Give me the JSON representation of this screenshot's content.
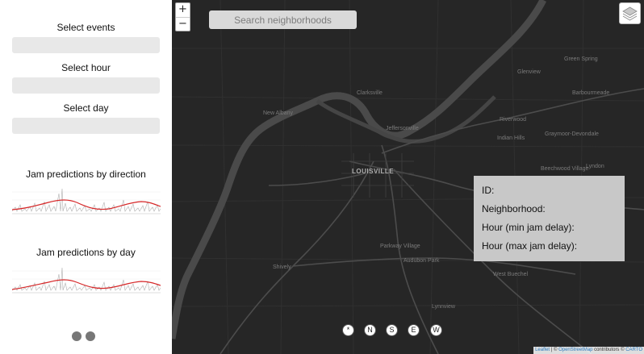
{
  "sidebar": {
    "select_events_label": "Select events",
    "select_hour_label": "Select hour",
    "select_day_label": "Select day",
    "chart_direction_title": "Jam predictions by direction",
    "chart_day_title": "Jam predictions by day",
    "select_events_value": "",
    "select_hour_value": "",
    "select_day_value": ""
  },
  "map": {
    "zoom_in": "+",
    "zoom_out": "−",
    "search_placeholder": "Search neighborhoods",
    "places": {
      "louisville": "LOUISVILLE",
      "new_albany": "New Albany",
      "clarksville": "Clarksville",
      "jeffersonville": "Jeffersonville",
      "shively": "Shively",
      "lyndon": "Lyndon",
      "green_spring": "Green Spring",
      "barbourmeade": "Barbourmeade",
      "riverwood": "Riverwood",
      "crossgate": "Graymoor-Devondale",
      "indian_hills": "Indian Hills",
      "beechwood": "Beechwood Village",
      "parkway": "Parkway Village",
      "audubon": "Audubon Park",
      "west_buechel": "West Buechel",
      "lynnview": "Lynnview",
      "glenview": "Glenview"
    },
    "info": {
      "id_label": "ID:",
      "neighborhood_label": "Neighborhood:",
      "hour_min_label": "Hour (min jam delay):",
      "hour_max_label": "Hour (max jam delay):"
    },
    "direction_buttons": [
      "*",
      "N",
      "S",
      "E",
      "W"
    ],
    "attribution": {
      "leaflet": "Leaflet",
      "sep": " | © ",
      "osm": "OpenStreetMap",
      "contrib": " contributors © ",
      "carto": "CARTO"
    }
  },
  "colors": {
    "map_bg": "#262626",
    "river": "#4a4a4a",
    "trend_line": "#d62728",
    "spikes": "#b0b0b0",
    "info_bg": "#c8c8c8"
  }
}
